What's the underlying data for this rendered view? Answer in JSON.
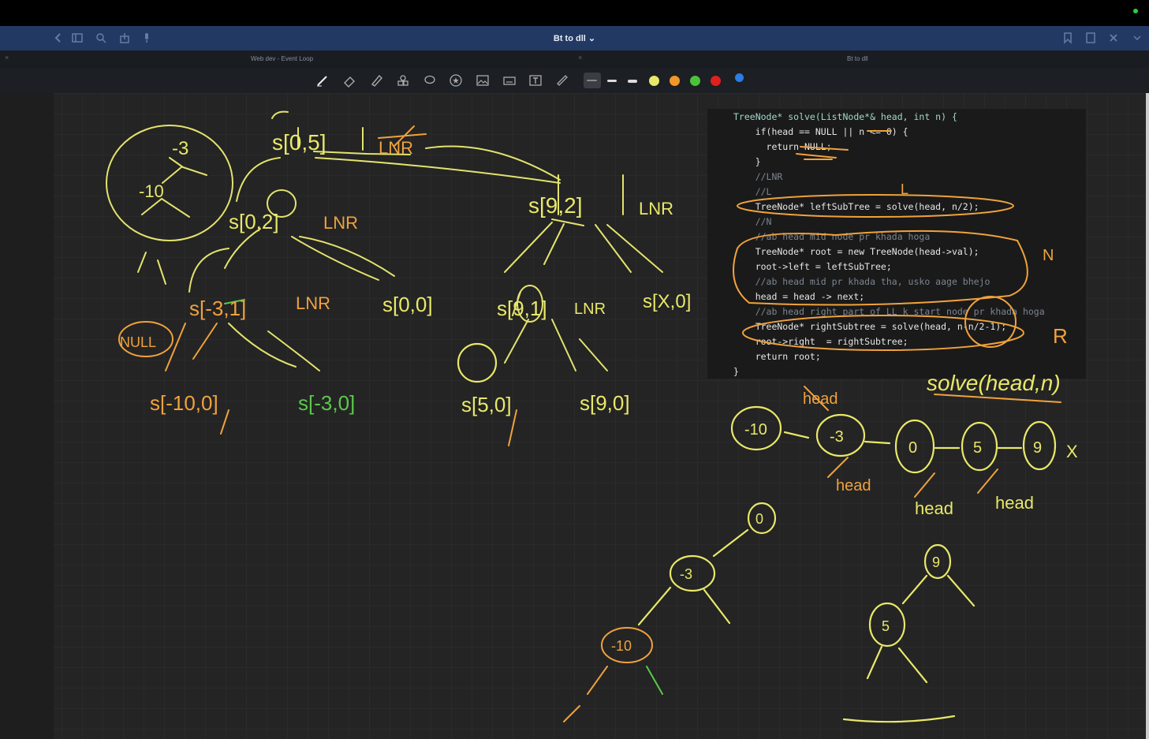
{
  "window": {
    "title": "Bt to dll ⌄"
  },
  "tabs": [
    {
      "label": "Web dev - Event Loop"
    },
    {
      "label": "Bt to dll"
    }
  ],
  "toolbar": {
    "colors": [
      "#e8e86a",
      "#f0962a",
      "#4cc23a",
      "#e0201e",
      "#2a7de1"
    ]
  },
  "code": {
    "lines": [
      "TreeNode* solve(ListNode*& head, int n) {",
      "    if(head == NULL || n <= 0) {",
      "      return NULL;",
      "    }",
      "    //LNR",
      "    //L",
      "    TreeNode* leftSubTree = solve(head, n/2);",
      "    //N",
      "    //ab head mid node pr khada hoga",
      "    TreeNode* root = new TreeNode(head->val);",
      "    root->left = leftSubTree;",
      "    //ab head mid pr khada tha, usko aage bhejo",
      "    head = head -> next;",
      "    //ab head right part of LL k start node pr khada hoga",
      "    TreeNode* rightSubtree = solve(head, n-n/2-1);",
      "    root->right  = rightSubtree;",
      "    return root;",
      "}"
    ]
  },
  "annotations": {
    "func_call": "solve(head,n)",
    "list_nodes": [
      "-10",
      "-3",
      "0",
      "5",
      "9"
    ],
    "list_end": "X",
    "tree_left": {
      "root": "0",
      "left": "-3",
      "leftleft": "-10"
    },
    "tree_right": {
      "root": "9",
      "left": "5"
    },
    "calls": [
      "s[0,5]",
      "s[0,2]",
      "s[9,2]",
      "s[-3,1]",
      "s[0,0]",
      "s[9,1]",
      "s[X,0]",
      "s[-10,0]",
      "s[-3,0]",
      "s[5,0]",
      "s[9,0]"
    ],
    "tree_top": {
      "root": "-3",
      "left": "-10"
    },
    "labels": {
      "lnr": "LNR",
      "null": "NULL",
      "head": "head",
      "n": "N",
      "r": "R",
      "l": "L"
    }
  }
}
